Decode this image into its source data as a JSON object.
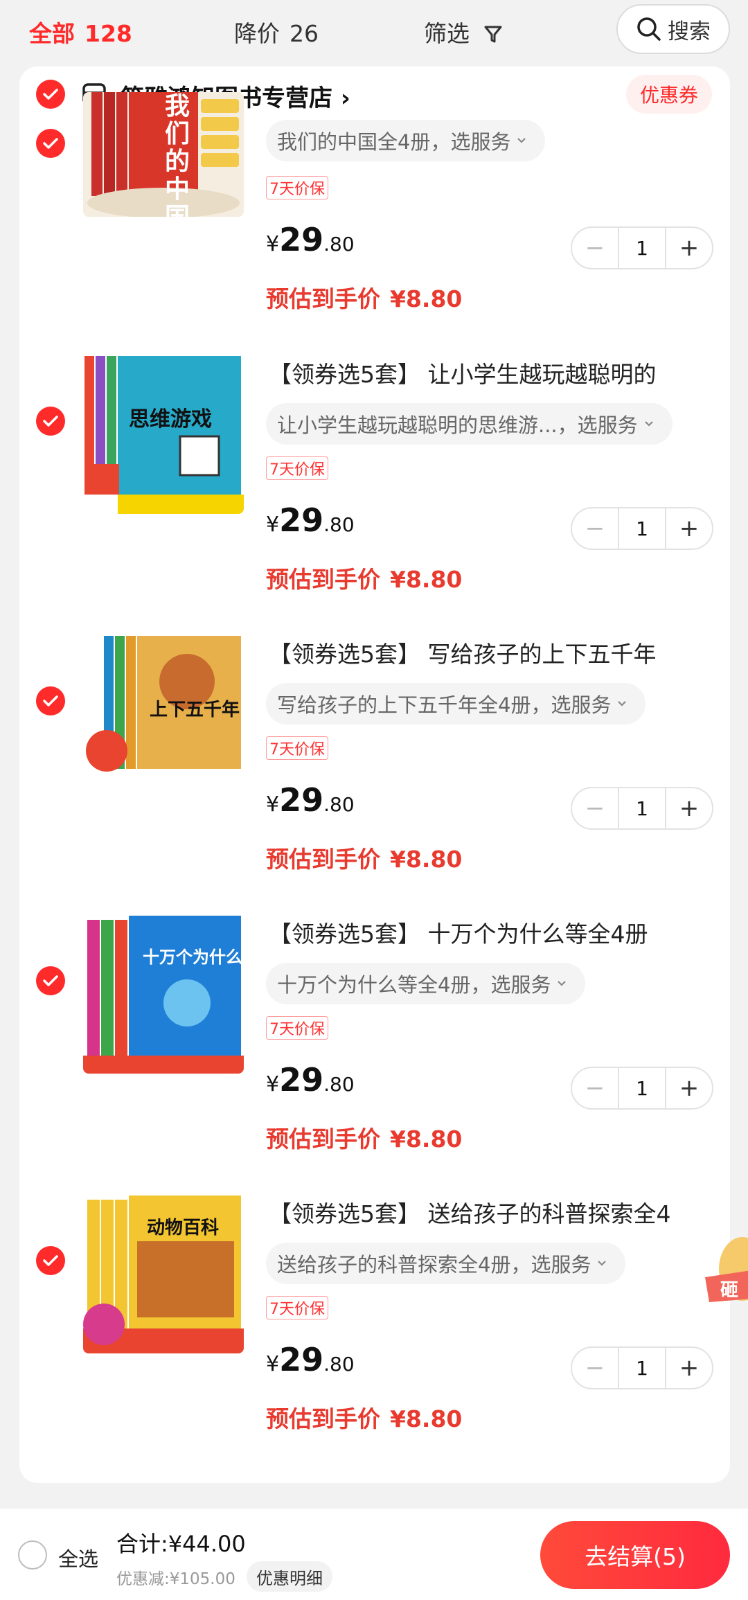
{
  "topbar": {
    "all_label": "全部",
    "all_count": "128",
    "drop_label": "降价",
    "drop_count": "26",
    "filter_label": "筛选",
    "search_label": "搜索",
    "accent_color": "#ff2a2a"
  },
  "store": {
    "name": "筠雅鸿知图书专营店",
    "chevron": "›",
    "coupon_label": "优惠券"
  },
  "items": [
    {
      "title": "",
      "sku": "我们的中国全4册，选服务",
      "tag": "7天价保",
      "price_yen": "¥",
      "price_int": "29",
      "price_dec": ".80",
      "qty": "1",
      "est_label": "预估到手价",
      "est_value": "¥8.80",
      "cover_text": "我们的中国",
      "cover_color": "#d9362a"
    },
    {
      "title": "【领券选5套】 让小学生越玩越聪明的",
      "sku": "让小学生越玩越聪明的思维游...，选服务",
      "tag": "7天价保",
      "price_yen": "¥",
      "price_int": "29",
      "price_dec": ".80",
      "qty": "1",
      "est_label": "预估到手价",
      "est_value": "¥8.80",
      "cover_text": "思维游戏",
      "cover_color": "#27a9c9"
    },
    {
      "title": "【领券选5套】 写给孩子的上下五千年",
      "sku": "写给孩子的上下五千年全4册，选服务",
      "tag": "7天价保",
      "price_yen": "¥",
      "price_int": "29",
      "price_dec": ".80",
      "qty": "1",
      "est_label": "预估到手价",
      "est_value": "¥8.80",
      "cover_text": "上下五千年",
      "cover_color": "#e7b04a"
    },
    {
      "title": "【领券选5套】 十万个为什么等全4册",
      "sku": "十万个为什么等全4册，选服务",
      "tag": "7天价保",
      "price_yen": "¥",
      "price_int": "29",
      "price_dec": ".80",
      "qty": "1",
      "est_label": "预估到手价",
      "est_value": "¥8.80",
      "cover_text": "十万个为什么",
      "cover_color": "#1f7fd6"
    },
    {
      "title": "【领券选5套】 送给孩子的科普探索全4",
      "sku": "送给孩子的科普探索全4册，选服务",
      "tag": "7天价保",
      "price_yen": "¥",
      "price_int": "29",
      "price_dec": ".80",
      "qty": "1",
      "est_label": "预估到手价",
      "est_value": "¥8.80",
      "cover_text": "动物百科",
      "cover_color": "#f2c531"
    }
  ],
  "side_badge": "砸",
  "bottom": {
    "select_all": "全选",
    "total": "合计:¥44.00",
    "discount": "优惠减:¥105.00",
    "detail": "优惠明细",
    "checkout": "去结算(5)"
  }
}
